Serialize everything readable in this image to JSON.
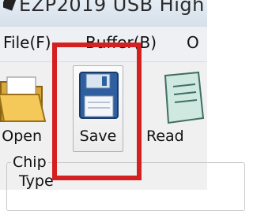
{
  "window": {
    "title": "EZP2019 USB High",
    "app_icon": "app-icon"
  },
  "menu": {
    "items": [
      {
        "label": "File(F)"
      },
      {
        "label": "Buffer(B)"
      },
      {
        "label": "O"
      }
    ]
  },
  "toolbar": {
    "buttons": [
      {
        "label": "Open",
        "icon": "folder-open-icon"
      },
      {
        "label": "Save",
        "icon": "floppy-disk-icon"
      },
      {
        "label": "Read",
        "icon": "notepad-icon"
      }
    ]
  },
  "chip_panel": {
    "legend": "Chip",
    "type_label": "Type"
  },
  "annotation": {
    "highlight_color": "#d42020",
    "target": "Save"
  }
}
